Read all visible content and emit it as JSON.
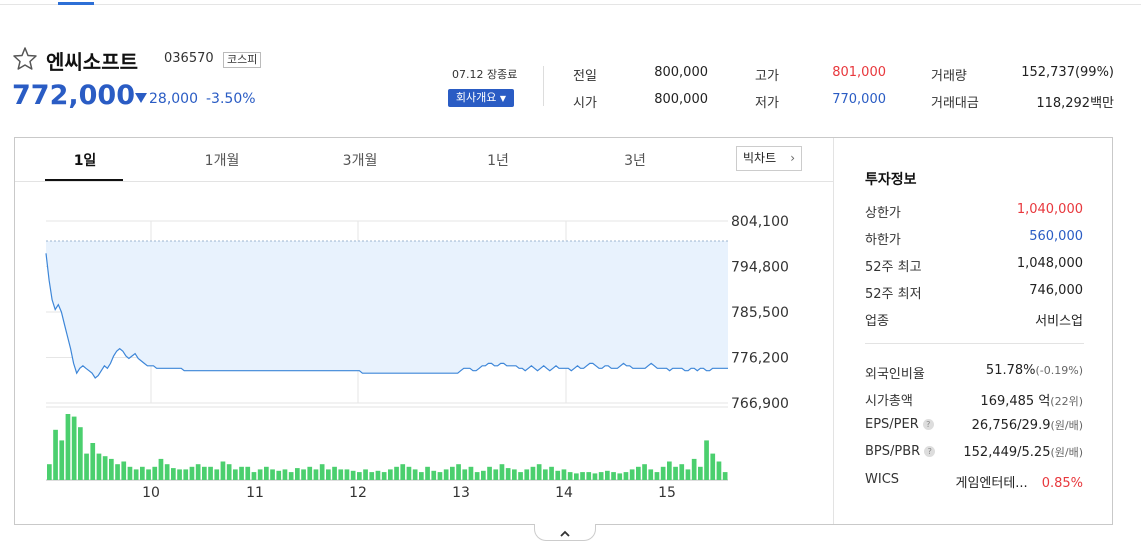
{
  "stock": {
    "name": "엔씨소프트",
    "code": "036570",
    "market": "코스피",
    "price": "772,000",
    "change": "28,000",
    "change_rate": "-3.50%",
    "market_status": "07.12 장종료",
    "company_button": "회사개요"
  },
  "quote": {
    "prev_label": "전일",
    "prev": "800,000",
    "high_label": "고가",
    "high": "801,000",
    "volume_label": "거래량",
    "volume": "152,737(99%)",
    "open_label": "시가",
    "open": "800,000",
    "low_label": "저가",
    "low": "770,000",
    "amount_label": "거래대금",
    "amount": "118,292백만"
  },
  "tabs": [
    "1일",
    "1개월",
    "3개월",
    "1년",
    "3년"
  ],
  "big_chart": "빅차트",
  "invest": {
    "title": "투자정보",
    "upper_label": "상한가",
    "upper": "1,040,000",
    "lower_label": "하한가",
    "lower": "560,000",
    "high52_label": "52주 최고",
    "high52": "1,048,000",
    "low52_label": "52주 최저",
    "low52": "746,000",
    "sector_label": "업종",
    "sector": "서비스업",
    "foreign_label": "외국인비율",
    "foreign": "51.78%",
    "foreign_chg": "(-0.19%)",
    "mcap_label": "시가총액",
    "mcap": "169,485",
    "mcap_unit": "억",
    "mcap_rank": "(22위)",
    "eps_label": "EPS/PER",
    "eps": "26,756/29.9",
    "eps_unit": "(원/배)",
    "bps_label": "BPS/PBR",
    "bps": "152,449/5.25",
    "bps_unit": "(원/배)",
    "wics_label": "WICS",
    "wics": "게임엔터테...",
    "wics_rate": "0.85%"
  },
  "colors": {
    "up": "#e8383d",
    "down": "#2a5cc4",
    "volume": "#4bcf6e",
    "area": "#e8f2fd",
    "line": "#3d86d8"
  },
  "chart_data": {
    "type": "line",
    "y_ticks": [
      "804,100",
      "794,800",
      "785,500",
      "776,200",
      "766,900"
    ],
    "ylim": [
      766900,
      804100
    ],
    "reference_line": 800000,
    "x_ticks": [
      "10",
      "11",
      "12",
      "13",
      "14",
      "15"
    ],
    "price": [
      797500,
      792000,
      788000,
      786000,
      787000,
      785500,
      783000,
      780500,
      778000,
      775000,
      773000,
      774000,
      774500,
      774000,
      773500,
      773000,
      772000,
      772500,
      773500,
      774500,
      774000,
      775000,
      776500,
      777500,
      778000,
      777500,
      776500,
      776000,
      776500,
      777000,
      776000,
      775500,
      775000,
      774500,
      774500,
      774500,
      774000,
      774000,
      774000,
      774000,
      774000,
      774000,
      774000,
      774000,
      774000,
      773500,
      773500,
      773500,
      773500,
      773500,
      773500,
      773500,
      773500,
      773500,
      773500,
      773500,
      773500,
      773500,
      773500,
      773500,
      773500,
      773500,
      773500,
      773500,
      773500,
      773500,
      773500,
      773500,
      773500,
      773500,
      773500,
      773500,
      773500,
      773500,
      773500,
      773500,
      773500,
      773500,
      773500,
      773500,
      773500,
      773500,
      773500,
      773500,
      773500,
      773500,
      773500,
      773500,
      773500,
      773500,
      773500,
      773500,
      773500,
      773500,
      773500,
      773500,
      773500,
      773500,
      773500,
      773500,
      773500,
      773500,
      773500,
      773000,
      773000,
      773000,
      773000,
      773000,
      773000,
      773000,
      773000,
      773000,
      773000,
      773000,
      773000,
      773000,
      773000,
      773000,
      773000,
      773000,
      773000,
      773000,
      773000,
      773000,
      773000,
      773000,
      773000,
      773000,
      773000,
      773000,
      773000,
      773000,
      773000,
      773000,
      773000,
      773500,
      774000,
      774000,
      774000,
      773500,
      773500,
      774000,
      774500,
      774500,
      775000,
      775000,
      774500,
      774500,
      775000,
      775000,
      774500,
      774500,
      774500,
      774500,
      774000,
      774000,
      773500,
      774000,
      774500,
      774000,
      773500,
      774000,
      774500,
      774000,
      773500,
      774000,
      774500,
      774000,
      774000,
      774000,
      774000,
      773500,
      774000,
      774500,
      774000,
      774000,
      774500,
      775000,
      775000,
      774500,
      774000,
      774000,
      774500,
      774500,
      774000,
      774000,
      774000,
      774500,
      775000,
      774500,
      774500,
      774000,
      774000,
      774000,
      774000,
      774000,
      774500,
      775000,
      774500,
      774000,
      774000,
      774000,
      774000,
      773500,
      774000,
      774000,
      774000,
      774000,
      773500,
      773500,
      774000,
      774000,
      773500,
      774000,
      774000,
      773500,
      773500,
      774000,
      774000,
      774000,
      774000,
      774000,
      774000
    ],
    "volume": [
      12,
      38,
      30,
      50,
      48,
      40,
      20,
      28,
      20,
      18,
      16,
      12,
      14,
      10,
      8,
      10,
      8,
      10,
      16,
      12,
      9,
      8,
      8,
      10,
      12,
      10,
      10,
      8,
      14,
      12,
      8,
      10,
      10,
      6,
      8,
      10,
      8,
      7,
      8,
      6,
      9,
      8,
      10,
      8,
      12,
      8,
      10,
      8,
      8,
      7,
      6,
      8,
      6,
      7,
      6,
      8,
      10,
      12,
      10,
      8,
      6,
      10,
      7,
      6,
      8,
      10,
      12,
      8,
      10,
      6,
      7,
      10,
      8,
      12,
      9,
      8,
      6,
      8,
      10,
      12,
      8,
      10,
      7,
      8,
      6,
      5,
      6,
      6,
      5,
      6,
      7,
      6,
      5,
      6,
      8,
      10,
      12,
      8,
      6,
      10,
      14,
      10,
      12,
      8,
      16,
      10,
      30,
      20,
      14,
      6
    ]
  }
}
